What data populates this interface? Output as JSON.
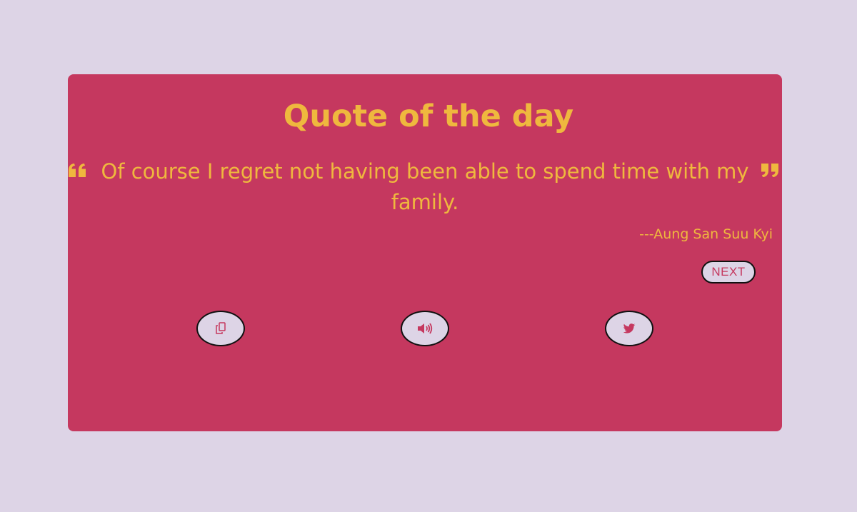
{
  "header": {
    "title": "Quote of the day"
  },
  "quote": {
    "text": "Of course I regret not having been able to spend time with my family.",
    "author": "---Aung San Suu Kyi",
    "open_icon": "quote-left-icon",
    "close_icon": "quote-right-icon"
  },
  "controls": {
    "next_label": "NEXT",
    "buttons": [
      {
        "name": "copy-button",
        "icon": "copy-icon"
      },
      {
        "name": "speak-button",
        "icon": "volume-icon"
      },
      {
        "name": "tweet-button",
        "icon": "twitter-icon"
      }
    ]
  },
  "colors": {
    "background": "#ddd4e6",
    "card": "#c5385f",
    "accent": "#efb83e"
  }
}
